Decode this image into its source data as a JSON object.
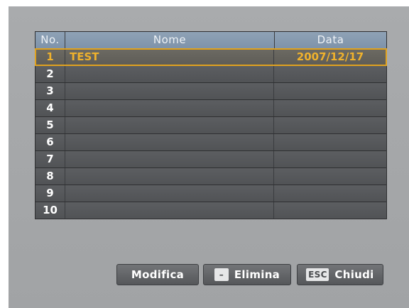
{
  "table": {
    "headers": {
      "no": "No.",
      "name": "Nome",
      "date": "Data"
    },
    "rows": [
      {
        "no": "1",
        "name": "TEST",
        "date": "2007/12/17",
        "selected": true
      },
      {
        "no": "2",
        "name": "",
        "date": ""
      },
      {
        "no": "3",
        "name": "",
        "date": ""
      },
      {
        "no": "4",
        "name": "",
        "date": ""
      },
      {
        "no": "5",
        "name": "",
        "date": ""
      },
      {
        "no": "6",
        "name": "",
        "date": ""
      },
      {
        "no": "7",
        "name": "",
        "date": ""
      },
      {
        "no": "8",
        "name": "",
        "date": ""
      },
      {
        "no": "9",
        "name": "",
        "date": ""
      },
      {
        "no": "10",
        "name": "",
        "date": ""
      }
    ]
  },
  "footer": {
    "modify_label": "Modifica",
    "delete_key": "–",
    "delete_label": "Elimina",
    "close_key": "ESC",
    "close_label": "Chiudi"
  },
  "colors": {
    "highlight": "#f0b22c",
    "header_bg": "#8699af",
    "row_bg": "#56585b",
    "screen_bg": "#a6a8aa"
  }
}
